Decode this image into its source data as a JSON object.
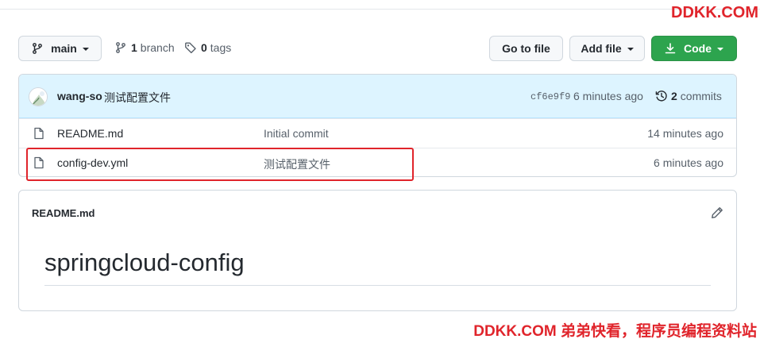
{
  "watermark": {
    "top": "DDKK.COM",
    "bottom": "DDKK.COM 弟弟快看，程序员编程资料站"
  },
  "toolbar": {
    "branch_label": "main",
    "branch_count": "1",
    "branch_word": "branch",
    "tag_count": "0",
    "tag_word": "tags",
    "goto_label": "Go to file",
    "addfile_label": "Add file",
    "code_label": "Code"
  },
  "commit": {
    "author": "wang-so",
    "message": "测试配置文件",
    "sha": "cf6e9f9",
    "time": "6 minutes ago",
    "count": "2",
    "count_word": "commits"
  },
  "files": [
    {
      "name": "README.md",
      "message": "Initial commit",
      "age": "14 minutes ago",
      "icon": "file-icon"
    },
    {
      "name": "config-dev.yml",
      "message": "测试配置文件",
      "age": "6 minutes ago",
      "icon": "file-icon"
    }
  ],
  "readme": {
    "title": "README.md",
    "heading": "springcloud-config"
  },
  "colors": {
    "accent_green": "#2da44e",
    "commit_bar": "#ddf4ff",
    "highlight_red": "#e0242b",
    "watermark_red": "#e0242b"
  }
}
